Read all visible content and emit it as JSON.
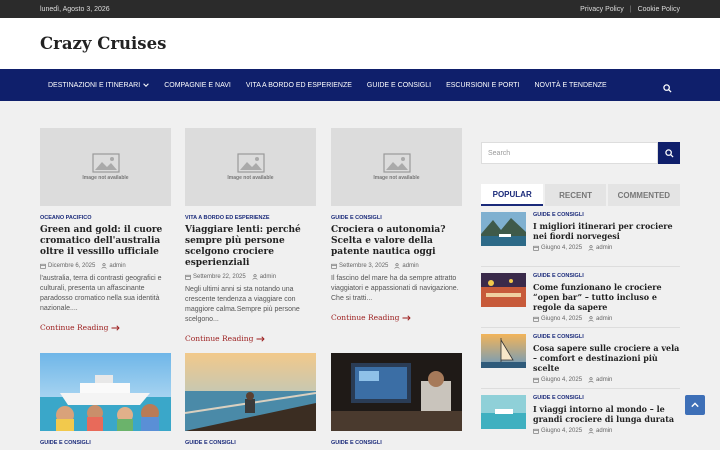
{
  "topbar": {
    "date": "lunedì, Agosto 3, 2026",
    "links": [
      "Privacy Policy",
      "Cookie Policy"
    ]
  },
  "site": {
    "title": "Crazy Cruises"
  },
  "nav": {
    "items": [
      "DESTINAZIONI E ITINERARI",
      "COMPAGNIE E NAVI",
      "VITA A BORDO ED ESPERIENZE",
      "GUIDE E CONSIGLI",
      "ESCURSIONI E PORTI",
      "NOVITÀ E TENDENZE"
    ]
  },
  "cards": [
    {
      "image_text": "Image not available",
      "category": "OCEANO PACIFICO",
      "title": "Green and gold: il cuore cromatico dell'australia oltre il vessillo ufficiale",
      "date": "Dicembre 6, 2025",
      "author": "admin",
      "excerpt": "l'australia, terra di contrasti geografici e culturali, presenta un affascinante paradosso cromatico nella sua identità nazionale....",
      "more": "Continue Reading"
    },
    {
      "image_text": "Image not available",
      "category": "VITA A BORDO ED ESPERIENZE",
      "title": "Viaggiare lenti: perché sempre più persone scelgono crociere esperienziali",
      "date": "Settembre 22, 2025",
      "author": "admin",
      "excerpt": "Negli ultimi anni si sta notando una crescente tendenza a viaggiare con maggiore calma.Sempre più persone scelgono...",
      "more": "Continue Reading"
    },
    {
      "image_text": "Image not available",
      "category": "GUIDE E CONSIGLI",
      "title": "Crociera o autonomia? Scelta e valore della patente nautica oggi",
      "date": "Settembre 3, 2025",
      "author": "admin",
      "excerpt": "Il fascino del mare ha da sempre attratto viaggiatori e appassionati di navigazione. Che si tratti...",
      "more": "Continue Reading"
    }
  ],
  "cards_row2": [
    {
      "category": "GUIDE E CONSIGLI"
    },
    {
      "category": "GUIDE E CONSIGLI"
    },
    {
      "category": "GUIDE E CONSIGLI"
    }
  ],
  "sidebar": {
    "search_placeholder": "Search",
    "tabs": [
      "POPULAR",
      "RECENT",
      "COMMENTED"
    ],
    "active_tab": "POPULAR",
    "posts": [
      {
        "category": "GUIDE E CONSIGLI",
        "title": "I migliori itinerari per crociere nei fiordi norvegesi",
        "date": "Giugno 4, 2025",
        "author": "admin"
      },
      {
        "category": "GUIDE E CONSIGLI",
        "title": "Come funzionano le crociere “open bar” – tutto incluso e regole da sapere",
        "date": "Giugno 4, 2025",
        "author": "admin"
      },
      {
        "category": "GUIDE E CONSIGLI",
        "title": "Cosa sapere sulle crociere a vela – comfort e destinazioni più scelte",
        "date": "Giugno 4, 2025",
        "author": "admin"
      },
      {
        "category": "GUIDE E CONSIGLI",
        "title": "I viaggi intorno al mondo – le grandi crociere di lunga durata",
        "date": "Giugno 4, 2025",
        "author": "admin"
      }
    ]
  },
  "colors": {
    "nav_bg": "#0f1f6b",
    "accent": "#1a2a7a",
    "link_red": "#9b1c1c",
    "totop": "#3d6fb7"
  },
  "icons": {
    "search": "search-icon",
    "calendar": "calendar-icon",
    "user": "user-icon",
    "arrow": "arrow-right-icon",
    "chevron": "chevron-down-icon",
    "totop": "chevron-up-icon"
  }
}
